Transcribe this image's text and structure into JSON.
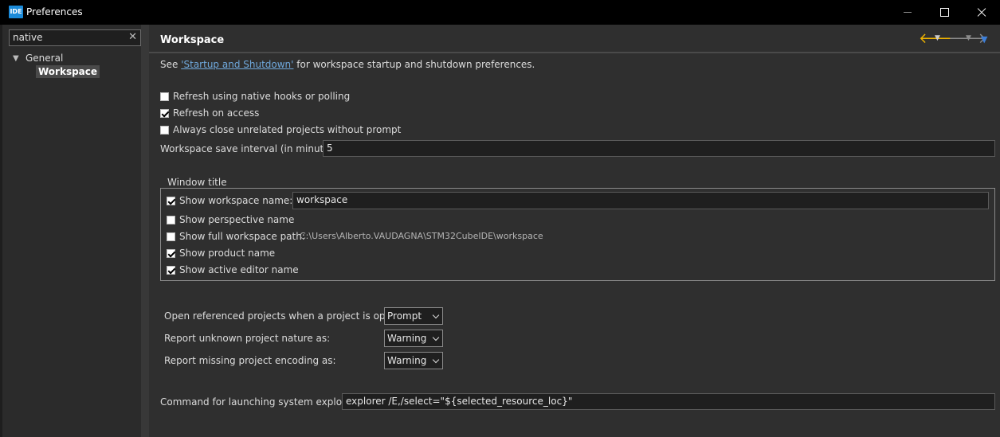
{
  "window": {
    "app_badge": "IDE",
    "title": "Preferences"
  },
  "left": {
    "filter_value": "native",
    "tree": {
      "general": "General",
      "workspace": "Workspace"
    }
  },
  "page": {
    "title": "Workspace",
    "see_prefix": "See ",
    "see_link": "'Startup and Shutdown'",
    "see_suffix": " for workspace startup and shutdown preferences.",
    "options": {
      "refresh_native": {
        "label": "Refresh using native hooks or polling",
        "checked": false
      },
      "refresh_access": {
        "label": "Refresh on access",
        "checked": true
      },
      "always_close": {
        "label": "Always close unrelated projects without prompt",
        "checked": false
      }
    },
    "save_interval_label": "Workspace save interval (in minutes):",
    "save_interval_value": "5",
    "window_title": {
      "legend": "Window title",
      "show_workspace_name": {
        "label": "Show workspace name:",
        "checked": true
      },
      "workspace_name_value": "workspace",
      "show_perspective_name": {
        "label": "Show perspective name",
        "checked": false
      },
      "show_full_path": {
        "label": "Show full workspace path:",
        "checked": false
      },
      "full_path_value": "C:\\Users\\Alberto.VAUDAGNA\\STM32CubeIDE\\workspace",
      "show_product_name": {
        "label": "Show product name",
        "checked": true
      },
      "show_active_editor": {
        "label": "Show active editor name",
        "checked": true
      }
    },
    "open_referenced": {
      "label": "Open referenced projects when a project is opened:",
      "value": "Prompt"
    },
    "report_unknown": {
      "label": "Report unknown project nature as:",
      "value": "Warning"
    },
    "report_missing": {
      "label": "Report missing project encoding as:",
      "value": "Warning"
    },
    "explorer": {
      "label": "Command for launching system explorer:",
      "value": "explorer /E,/select=\"${selected_resource_loc}\""
    }
  },
  "colors": {
    "accent_link": "#6fa8dc",
    "back_arrow": "#f0b400",
    "menu_arrow": "#3d7fd8"
  }
}
